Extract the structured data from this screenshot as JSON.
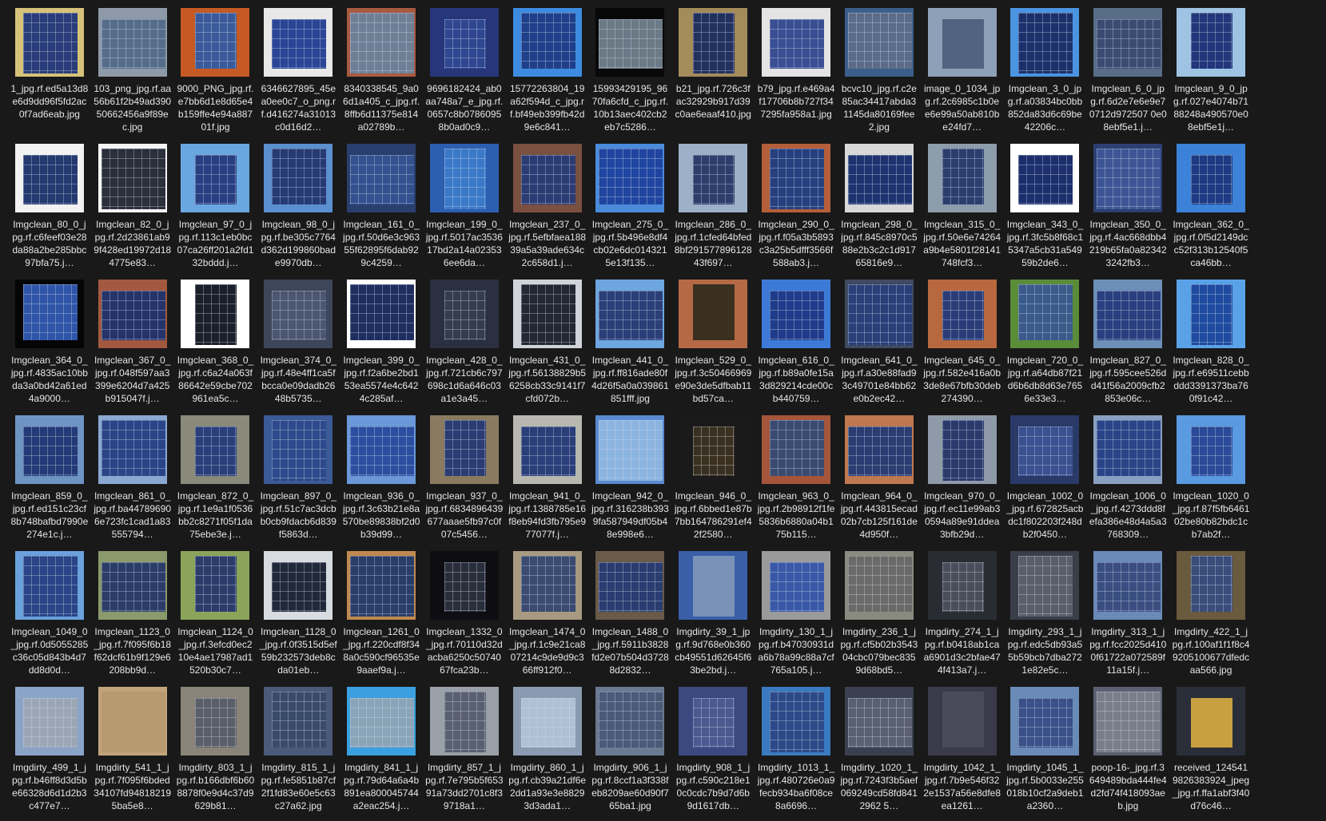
{
  "files": [
    {
      "name": "1_jpg.rf.ed5a13d8e6d9dd96f5fd2ac0f7ad6eab.jpg",
      "thumb": {
        "bg": "#d7c27a",
        "panel": "#2a3d7a",
        "grid": true
      }
    },
    {
      "name": "103_png_jpg.rf.aa56b61f2b49ad39050662456a9f89ec.jpg",
      "thumb": {
        "bg": "#8e9aa8",
        "panel": "#566d8a",
        "grid": true
      }
    },
    {
      "name": "9000_PNG_jpg.rf.e7bb6d1e8d65e4b159ffe4e94a88701f.jpg",
      "thumb": {
        "bg": "#c65a25",
        "panel": "#3a5a9a",
        "grid": true
      }
    },
    {
      "name": "6346627895_45ea0ee0c7_o_png.rf.d416274a31013c0d16d2…",
      "thumb": {
        "bg": "#e8e8e8",
        "panel": "#2b4596",
        "grid": true
      }
    },
    {
      "name": "8340338545_9a06d1a405_c_jpg.rf.8ffb6d11375e814a02789b…",
      "thumb": {
        "bg": "#a85a40",
        "panel": "#6f7f96",
        "grid": true
      }
    },
    {
      "name": "9696182424_ab0aa748a7_e_jpg.rf.0657c8b07860958b0ad0c9…",
      "thumb": {
        "bg": "#27357a",
        "panel": "#2f4690",
        "grid": true
      }
    },
    {
      "name": "15772263804_19a62f594d_c_jpg.rf.bf49eb399fb42d9e6c841…",
      "thumb": {
        "bg": "#3d8be0",
        "panel": "#1f3f8a",
        "grid": true
      }
    },
    {
      "name": "15993429195_9670fa6cfd_c_jpg.rf.10b13aec402cb2eb7c5286…",
      "thumb": {
        "bg": "#080808",
        "panel": "#6b7a86",
        "grid": true
      }
    },
    {
      "name": "b21_jpg.rf.726c3fac32929b917d39c0ae6eaaf410.jpg",
      "thumb": {
        "bg": "#a48b5a",
        "panel": "#22305e",
        "grid": true
      }
    },
    {
      "name": "b79_jpg.rf.e469a4f17706b8b727f347295fa958a1.jpg",
      "thumb": {
        "bg": "#e4e4e4",
        "panel": "#3a4e94",
        "grid": true
      }
    },
    {
      "name": "bcvc10_jpg.rf.c2e85ac34417abda31145da80169fee2.jpg",
      "thumb": {
        "bg": "#3b5f8a",
        "panel": "#5b6c8a",
        "grid": true
      }
    },
    {
      "name": "image_0_1034_jpg.rf.2c6985c1b0ee6e99a50ab810be24fd7…",
      "thumb": {
        "bg": "#8e9fb8",
        "panel": "#506481",
        "grid": false
      }
    },
    {
      "name": "Imgclean_3_0_jpg.rf.a03834bc0bb852da83d6c69be42206c…",
      "thumb": {
        "bg": "#4b94e2",
        "panel": "#1c316c",
        "grid": true
      }
    },
    {
      "name": "Imgclean_6_0_jpg.rf.6d2e7e6e9e70712d972507 0e08ebf5e1.j…",
      "thumb": {
        "bg": "#576c86",
        "panel": "#3a4c72",
        "grid": true
      }
    },
    {
      "name": "Imgclean_9_0_jpg.rf.027e4074b7188248a490570e08ebf5e1j…",
      "thumb": {
        "bg": "#9fc4e3",
        "panel": "#23367a",
        "grid": true
      }
    },
    {
      "name": "Imgclean_80_0_jpg.rf.c6feef03e28da88a2be285bbc97bfa75.j…",
      "thumb": {
        "bg": "#f2f2f2",
        "panel": "#24396f",
        "grid": true
      }
    },
    {
      "name": "Imgclean_82_0_jpg.rf.2d23861ab99f428ed19972d184775e83…",
      "thumb": {
        "bg": "#f5f5f5",
        "panel": "#2a2f3a",
        "grid": true
      }
    },
    {
      "name": "Imgclean_97_0_jpg.rf.113c1eb0bc07ca26ff201a2fd132bddd.j…",
      "thumb": {
        "bg": "#6aa7e0",
        "panel": "#283f82",
        "grid": true
      }
    },
    {
      "name": "Imgclean_98_0_jpg.rf.be305c7764d362d199860bade9970db…",
      "thumb": {
        "bg": "#5a8fd0",
        "panel": "#263a74",
        "grid": true
      }
    },
    {
      "name": "Imgclean_161_0_jpg.rf.50d6e3c96355f62895f6dab929c4259…",
      "thumb": {
        "bg": "#2b3f6f",
        "panel": "#33508f",
        "grid": true
      }
    },
    {
      "name": "Imgclean_199_0_jpg.rf.5017ac353617bd2a14a023536ee6da…",
      "thumb": {
        "bg": "#2d5fb0",
        "panel": "#3b78c8",
        "grid": true
      }
    },
    {
      "name": "Imgclean_237_0_jpg.rf.5efbfaea18839a5a39ade634c2c658d1.j…",
      "thumb": {
        "bg": "#7a5040",
        "panel": "#2b3b73",
        "grid": true
      }
    },
    {
      "name": "Imgclean_275_0_jpg.rf.5b496e8df4cb02e6dc0143215e13f135…",
      "thumb": {
        "bg": "#4b8bdc",
        "panel": "#1f45a0",
        "grid": true
      }
    },
    {
      "name": "Imgclean_286_0_jpg.rf.1cfed64bfed8bf29157789612843f697…",
      "thumb": {
        "bg": "#9cb0c8",
        "panel": "#2d3e6c",
        "grid": true
      }
    },
    {
      "name": "Imgclean_290_0_jpg.rf.f05a3b5893c3a25b5dfff3566f588ab3.j…",
      "thumb": {
        "bg": "#b55f3a",
        "panel": "#26407e",
        "grid": true
      }
    },
    {
      "name": "Imgclean_298_0_jpg.rf.845c8970c588e2b3c2c1d91765816e9…",
      "thumb": {
        "bg": "#d8d8d8",
        "panel": "#1f3270",
        "grid": true
      }
    },
    {
      "name": "Imgclean_315_0_jpg.rf.50e6e74264a9b4e5801f28141748fcf3…",
      "thumb": {
        "bg": "#8e9dac",
        "panel": "#2c3e6e",
        "grid": true
      }
    },
    {
      "name": "Imgclean_343_0_jpg.rf.3fc5b8f68c15347a5cb31a54959b2de6…",
      "thumb": {
        "bg": "#ffffff",
        "panel": "#1c2f6c",
        "grid": true
      }
    },
    {
      "name": "Imgclean_350_0_jpg.rf.4ac668dbb4219b65fa0a823423242fb3…",
      "thumb": {
        "bg": "#2c3f72",
        "panel": "#3d5595",
        "grid": true
      }
    },
    {
      "name": "Imgclean_362_0_jpg.rf.0f5d2149dcc52f313b12540f5ca46bb…",
      "thumb": {
        "bg": "#3b82d8",
        "panel": "#1d3a82",
        "grid": true
      }
    },
    {
      "name": "Imgclean_364_0_jpg.rf.4835ac10bbda3a0bd42a61ed4a9000…",
      "thumb": {
        "bg": "#050505",
        "panel": "#2f55a8",
        "grid": true
      }
    },
    {
      "name": "Imgclean_367_0_jpg.rf.048f597aa3399e6204d7a425b915047f.j…",
      "thumb": {
        "bg": "#a35840",
        "panel": "#24336a",
        "grid": true
      }
    },
    {
      "name": "Imgclean_368_0_jpg.rf.c6a24a063f86642e59cbe702961ea5c…",
      "thumb": {
        "bg": "#ffffff",
        "panel": "#1a1f2a",
        "grid": true
      }
    },
    {
      "name": "Imgclean_374_0_jpg.rf.48e4ff1ca5fbcca0e09dadb2648b5735…",
      "thumb": {
        "bg": "#3d465a",
        "panel": "#4b5670",
        "grid": true
      }
    },
    {
      "name": "Imgclean_399_0_jpg.rf.f2a6be2bd153ea5574e4c6424c285af…",
      "thumb": {
        "bg": "#ffffff",
        "panel": "#1e2e5e",
        "grid": true
      }
    },
    {
      "name": "Imgclean_428_0_jpg.rf.721cb6c797698c1d6a646c03a1e3a45…",
      "thumb": {
        "bg": "#2a3040",
        "panel": "#363c4c",
        "grid": true
      }
    },
    {
      "name": "Imgclean_431_0_jpg.rf.56138829b56258cb33c9141f7cfd072b…",
      "thumb": {
        "bg": "#d0d4da",
        "panel": "#232733",
        "grid": true
      }
    },
    {
      "name": "Imgclean_441_0_jpg.rf.ff816ade80f4d26f5a0a039861851fff.jpg",
      "thumb": {
        "bg": "#6ea6e0",
        "panel": "#2a3f78",
        "grid": true
      }
    },
    {
      "name": "Imgclean_529_0_jpg.rf.3c50466969e90e3de5dfbab11bd57ca…",
      "thumb": {
        "bg": "#b56a45",
        "panel": "#3a3020",
        "grid": false
      }
    },
    {
      "name": "Imgclean_616_0_jpg.rf.b89a0fe15a3d829214cde00cb440759…",
      "thumb": {
        "bg": "#3d7ad8",
        "panel": "#1f3c8a",
        "grid": true
      }
    },
    {
      "name": "Imgclean_641_0_jpg.rf.a30e88fad93c49701e84bb62e0b2ec42…",
      "thumb": {
        "bg": "#3f4a60",
        "panel": "#2a3e78",
        "grid": true
      }
    },
    {
      "name": "Imgclean_645_0_jpg.rf.582e416a0b3de8e67bfb30deb274390…",
      "thumb": {
        "bg": "#b8683e",
        "panel": "#2a3c78",
        "grid": true
      }
    },
    {
      "name": "Imgclean_720_0_jpg.rf.a64db87f21d6b6db8d63e7656e33e3…",
      "thumb": {
        "bg": "#5a8c3a",
        "panel": "#3a5a8a",
        "grid": true
      }
    },
    {
      "name": "Imgclean_827_0_jpg.rf.595cee526dd41f56a2009cfb2853e06c…",
      "thumb": {
        "bg": "#6c8fb8",
        "panel": "#2a3f80",
        "grid": true
      }
    },
    {
      "name": "Imgclean_828_0_jpg.rf.e69511cebbddd3391373ba760f91c42…",
      "thumb": {
        "bg": "#5aa2e8",
        "panel": "#1f4aa0",
        "grid": true
      }
    },
    {
      "name": "Imgclean_859_0_jpg.rf.ed151c23cf8b748bafbd7990e274e1c.j…",
      "thumb": {
        "bg": "#6e94c4",
        "panel": "#233a78",
        "grid": true
      }
    },
    {
      "name": "Imgclean_861_0_jpg.rf.ba447896906e723fc1cad1a83555794…",
      "thumb": {
        "bg": "#8aa8d2",
        "panel": "#2b4488",
        "grid": true
      }
    },
    {
      "name": "Imgclean_872_0_jpg.rf.1e9a1f0536bb2c8271f05f1da75ebe3e.j…",
      "thumb": {
        "bg": "#8a8a7a",
        "panel": "#2a3e7a",
        "grid": true
      }
    },
    {
      "name": "Imgclean_897_0_jpg.rf.51c7ac3dcbb0cb9fdacb6d839f5863d…",
      "thumb": {
        "bg": "#3a5a98",
        "panel": "#2c4a8c",
        "grid": true
      }
    },
    {
      "name": "Imgclean_936_0_jpg.rf.3c63b21e8a570be89838bf2d0b39d99…",
      "thumb": {
        "bg": "#6a98d8",
        "panel": "#2b4ea0",
        "grid": true
      }
    },
    {
      "name": "Imgclean_937_0_jpg.rf.6834896439677aaae5fb97c0f07c5456…",
      "thumb": {
        "bg": "#8a7a60",
        "panel": "#2a3c72",
        "grid": true
      }
    },
    {
      "name": "Imgclean_941_0_jpg.rf.1388785e16f8eb94fd3fb795e977077f.j…",
      "thumb": {
        "bg": "#b8b8b0",
        "panel": "#2a3e7a",
        "grid": true
      }
    },
    {
      "name": "Imgclean_942_0_jpg.rf.316238b3939fa587949df05b48e998e6…",
      "thumb": {
        "bg": "#5a8ad0",
        "panel": "#8cb4e0",
        "grid": true
      }
    },
    {
      "name": "Imgclean_946_0_jpg.rf.6bbed1e87b7bb164786291ef42f2580…",
      "thumb": {
        "bg": "#1a1a1a",
        "panel": "#3a3020",
        "grid": true
      }
    },
    {
      "name": "Imgclean_963_0_jpg.rf.2b98912f1fe5836b6880a04b175b115…",
      "thumb": {
        "bg": "#a4553a",
        "panel": "#3a4a70",
        "grid": true
      }
    },
    {
      "name": "Imgclean_964_0_jpg.rf.443815ecad02b7cb125f161de4d950f…",
      "thumb": {
        "bg": "#c07850",
        "panel": "#2b3c72",
        "grid": true
      }
    },
    {
      "name": "Imgclean_970_0_jpg.rf.ec11e99ab30594a89e91ddea3bfb29d…",
      "thumb": {
        "bg": "#8e9aa8",
        "panel": "#2a3a6c",
        "grid": true
      }
    },
    {
      "name": "Imgclean_1002_0_jpg.rf.672825acbdc1f802203f248db2f0450…",
      "thumb": {
        "bg": "#2a3a68",
        "panel": "#3a5090",
        "grid": true
      }
    },
    {
      "name": "Imgclean_1006_0_jpg.rf.4273ddd8fefa386e48d4a5a3768309…",
      "thumb": {
        "bg": "#8aa0c0",
        "panel": "#2a4488",
        "grid": true
      }
    },
    {
      "name": "Imgclean_1020_0_jpg.rf.87f5fb646102be80b82bdc1cb7ab2f…",
      "thumb": {
        "bg": "#5a9ae0",
        "panel": "#2a4a98",
        "grid": true
      }
    },
    {
      "name": "Imgclean_1049_0_jpg.rf.0d5055285c36c05d843b4d7dd8d0d…",
      "thumb": {
        "bg": "#6aa0dc",
        "panel": "#2a4488",
        "grid": true
      }
    },
    {
      "name": "Imgclean_1123_0_jpg.rf.7f095f6b18f62dcf61b9f129e6208bb9d…",
      "thumb": {
        "bg": "#8a9a6a",
        "panel": "#2c3c68",
        "grid": true
      }
    },
    {
      "name": "Imgclean_1124_0_jpg.rf.3efcd0ec210e4ae17987ad1520b30c7…",
      "thumb": {
        "bg": "#8ca45a",
        "panel": "#2c3c6a",
        "grid": true
      }
    },
    {
      "name": "Imgclean_1128_0_jpg.rf.0f3515d5ef59b232573deb8cda01eb…",
      "thumb": {
        "bg": "#d8dce0",
        "panel": "#20283a",
        "grid": true
      }
    },
    {
      "name": "Imgclean_1261_0_jpg.rf.220cdf8f348a0c590cf96535e9aaef9a.j…",
      "thumb": {
        "bg": "#c08a50",
        "panel": "#2a3c68",
        "grid": true
      }
    },
    {
      "name": "Imgclean_1332_0_jpg.rf.70110d32dacba6250c5074067fca23b…",
      "thumb": {
        "bg": "#0e0e12",
        "panel": "#2a2e3a",
        "grid": true
      }
    },
    {
      "name": "Imgclean_1474_0_jpg.rf.1c9e21ca807214c9de9d9c366ff912f0…",
      "thumb": {
        "bg": "#a89a80",
        "panel": "#3a4a70",
        "grid": true
      }
    },
    {
      "name": "Imgclean_1488_0_jpg.rf.5911b3828fd2e07b504d37288d2832…",
      "thumb": {
        "bg": "#6a5a4a",
        "panel": "#2a3c70",
        "grid": true
      }
    },
    {
      "name": "Imgdirty_39_1_jpg.rf.9d768e0b360cb49551d62645f63be2bd.j…",
      "thumb": {
        "bg": "#3a5ea8",
        "panel": "#7a92b8",
        "grid": false
      }
    },
    {
      "name": "Imgdirty_130_1_jpg.rf.b47030931da6b78a99c88a7cf765a105.j…",
      "thumb": {
        "bg": "#9a9a9a",
        "panel": "#3a58a8",
        "grid": true
      }
    },
    {
      "name": "Imgdirty_236_1_jpg.rf.cf5b02b354304cbc079bec8359d68bd5…",
      "thumb": {
        "bg": "#8a8a80",
        "panel": "#6a6a68",
        "grid": true
      }
    },
    {
      "name": "Imgdirty_274_1_jpg.rf.b0418ab1caa6901d3c2bfae474f413a7.j…",
      "thumb": {
        "bg": "#2a2c34",
        "panel": "#4a4e5a",
        "grid": true
      }
    },
    {
      "name": "Imgdirty_293_1_jpg.rf.edc5db93a55b59bcb7dba2721e82e5c…",
      "thumb": {
        "bg": "#3a3e48",
        "panel": "#5a5e6a",
        "grid": true
      }
    },
    {
      "name": "Imgdirty_313_1_jpg.rf.fcc2025d4100f61722a072589f11a15f.j…",
      "thumb": {
        "bg": "#6a8ab8",
        "panel": "#3a4e80",
        "grid": true
      }
    },
    {
      "name": "Imgdirty_422_1_jpg.rf.100af1f1f8c49205100677dfedcaa566.jpg",
      "thumb": {
        "bg": "#6a5a3e",
        "panel": "#3a4c7a",
        "grid": true
      }
    },
    {
      "name": "Imgdirty_499_1_jpg.rf.b46ff8d3d5be66328d6d1d2b3c477e7…",
      "thumb": {
        "bg": "#8aa4c8",
        "panel": "#9aa6b4",
        "grid": true
      }
    },
    {
      "name": "Imgdirty_541_1_jpg.rf.7f095f6bded34107fd948182195ba5e8…",
      "thumb": {
        "bg": "#c2a47c",
        "panel": "#b89a70",
        "grid": false
      }
    },
    {
      "name": "Imgdirty_803_1_jpg.rf.b166dbf6b608878f0e9d4c37d9629b81…",
      "thumb": {
        "bg": "#8a8478",
        "panel": "#5a5e68",
        "grid": true
      }
    },
    {
      "name": "Imgdirty_815_1_jpg.rf.fe5851b87cf2f1fd83e60e5c63c27a62.jpg",
      "thumb": {
        "bg": "#4a5a78",
        "panel": "#3a4a6a",
        "grid": true
      }
    },
    {
      "name": "Imgdirty_841_1_jpg.rf.79d64a6a4b891ea800045744a2eac254.j…",
      "thumb": {
        "bg": "#3aa0e0",
        "panel": "#8aa4b8",
        "grid": true
      }
    },
    {
      "name": "Imgdirty_857_1_jpg.rf.7e795b5f65391a73dd2701c8f39718a1…",
      "thumb": {
        "bg": "#9aa0a8",
        "panel": "#5a6070",
        "grid": true
      }
    },
    {
      "name": "Imgdirty_860_1_jpg.rf.cb39a21df6e2dd1a93e3e88293d3ada1…",
      "thumb": {
        "bg": "#8a9ab0",
        "panel": "#b0c0d4",
        "grid": true
      }
    },
    {
      "name": "Imgdirty_906_1_jpg.rf.8ccf1a3f338feb8209ae60d90f765ba1.jpg",
      "thumb": {
        "bg": "#6a7a90",
        "panel": "#4a5a78",
        "grid": true
      }
    },
    {
      "name": "Imgdirty_908_1_jpg.rf.c590c218e10c0cdc7b9d7d6b9d1617db…",
      "thumb": {
        "bg": "#3a4a80",
        "panel": "#4a5a90",
        "grid": true
      }
    },
    {
      "name": "Imgdirty_1013_1_jpg.rf.480726e0a9fecb934ba6f08ce8a6696…",
      "thumb": {
        "bg": "#3a7ac0",
        "panel": "#2c4a88",
        "grid": true
      }
    },
    {
      "name": "Imgdirty_1020_1_jpg.rf.7243f3b5aef069249cd58fd8412962 5…",
      "thumb": {
        "bg": "#3a4050",
        "panel": "#5a6070",
        "grid": true
      }
    },
    {
      "name": "Imgdirty_1042_1_jpg.rf.7b9e546f322e1537a56e8dfe8ea1261…",
      "thumb": {
        "bg": "#3a3a4a",
        "panel": "#4a4a5a",
        "grid": false
      }
    },
    {
      "name": "Imgdirty_1045_1_jpg.rf.5b0033e255018b10cf2a9deb1a2360…",
      "thumb": {
        "bg": "#6a8ab8",
        "panel": "#3a5088",
        "grid": true
      }
    },
    {
      "name": "poop-16-_jpg.rf.3649489bda444fe4d2fd74f418093aeb.jpg",
      "thumb": {
        "bg": "#5a6070",
        "panel": "#7a7e88",
        "grid": true
      }
    },
    {
      "name": "received_1245419826383924_jpeg_jpg.rf.ffa1abf3f40d76c46…",
      "thumb": {
        "bg": "#2a2e38",
        "panel": "#c8a040",
        "grid": false
      }
    }
  ]
}
